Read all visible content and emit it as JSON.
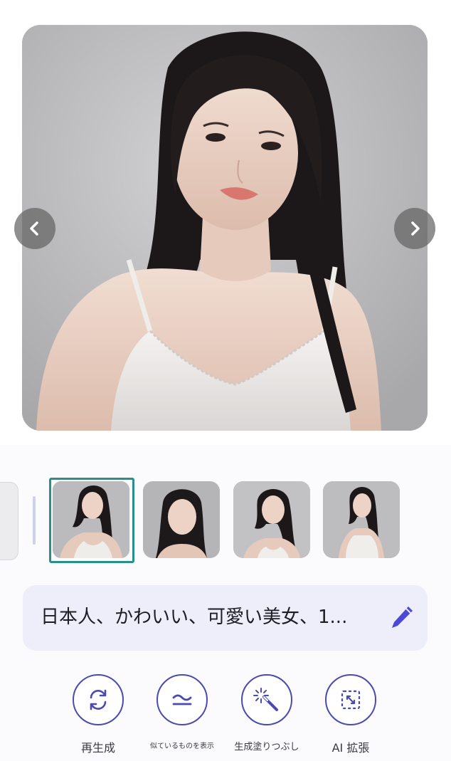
{
  "prompt": {
    "text": "日本人、かわいい、可愛い美女、1..."
  },
  "actions": [
    {
      "label": "再生成",
      "icon": "regenerate-icon"
    },
    {
      "label": "似ているものを表示",
      "icon": "similar-icon"
    },
    {
      "label": "生成塗りつぶし",
      "icon": "magic-wand-icon"
    },
    {
      "label": "AI 拡張",
      "icon": "expand-icon"
    }
  ],
  "gallery": {
    "selected_index": 0,
    "thumbnail_count": 4
  },
  "icons": {
    "prev": "chevron-left-icon",
    "next": "chevron-right-icon",
    "edit": "pen-icon"
  },
  "colors": {
    "accent": "#4b4ab0",
    "selected_border": "#2a8f88",
    "prompt_background": "#eeeefb"
  }
}
